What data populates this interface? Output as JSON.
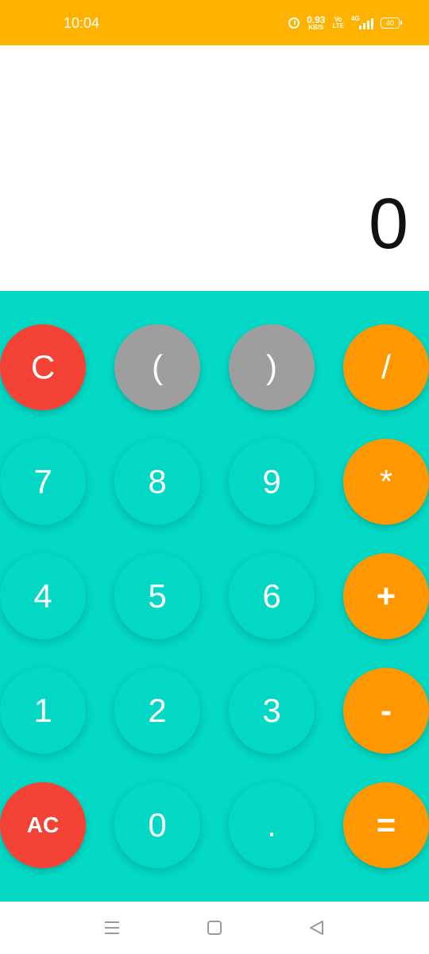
{
  "status_bar": {
    "time": "10:04",
    "net_speed_value": "0.93",
    "net_speed_unit": "KB/S",
    "volte_top": "Vo",
    "volte_bottom": "LTE",
    "network": "4G",
    "battery": "40",
    "background_color": "#FFB300"
  },
  "display": {
    "value": "0"
  },
  "keypad": {
    "background_color": "#02D8C4",
    "keys": {
      "c": "C",
      "open_paren": "(",
      "close_paren": ")",
      "divide": "/",
      "seven": "7",
      "eight": "8",
      "nine": "9",
      "multiply": "*",
      "four": "4",
      "five": "5",
      "six": "6",
      "plus": "+",
      "one": "1",
      "two": "2",
      "three": "3",
      "minus": "-",
      "ac": "AC",
      "zero": "0",
      "decimal": ".",
      "equals": "="
    },
    "colors": {
      "clear": "#F44336",
      "paren": "#9E9E9E",
      "operator": "#FF9800"
    }
  },
  "nav_bar": {
    "icons": [
      "menu-icon",
      "home-icon",
      "back-icon"
    ]
  }
}
